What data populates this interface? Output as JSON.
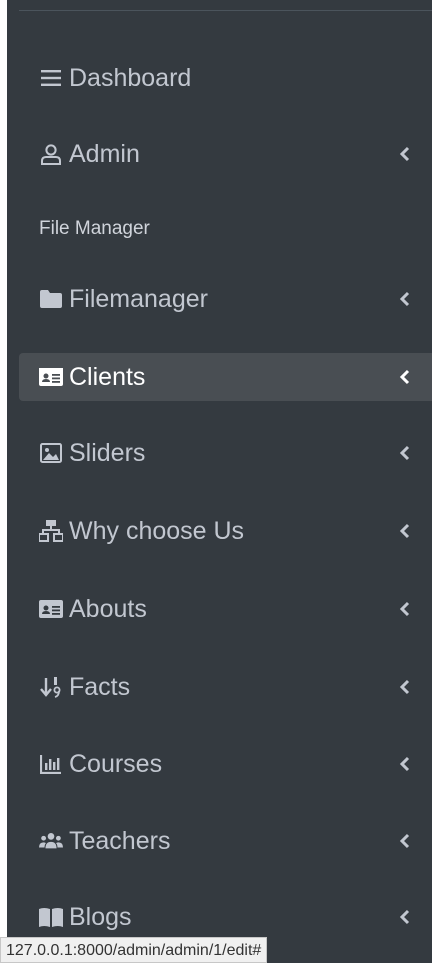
{
  "colors": {
    "sidebar_bg": "#343a40",
    "active_bg": "#494e53",
    "text": "#c2c7d0",
    "active_text": "#ffffff"
  },
  "nav": {
    "dashboard": {
      "label": "Dashboard",
      "icon": "bars-icon"
    },
    "admin": {
      "label": "Admin",
      "icon": "user-icon"
    },
    "file_manager_header": "File Manager",
    "filemanager": {
      "label": "Filemanager",
      "icon": "folder-icon"
    },
    "clients": {
      "label": "Clients",
      "icon": "id-card-icon",
      "active": true
    },
    "sliders": {
      "label": "Sliders",
      "icon": "image-icon"
    },
    "why_choose_us": {
      "label": "Why choose Us",
      "icon": "sitemap-icon"
    },
    "abouts": {
      "label": "Abouts",
      "icon": "id-card-icon"
    },
    "facts": {
      "label": "Facts",
      "icon": "sort-numeric-icon"
    },
    "courses": {
      "label": "Courses",
      "icon": "chart-bar-icon"
    },
    "teachers": {
      "label": "Teachers",
      "icon": "users-icon"
    },
    "blogs": {
      "label": "Blogs",
      "icon": "book-icon"
    }
  },
  "status_bar": {
    "url": "127.0.0.1:8000/admin/admin/1/edit#"
  }
}
